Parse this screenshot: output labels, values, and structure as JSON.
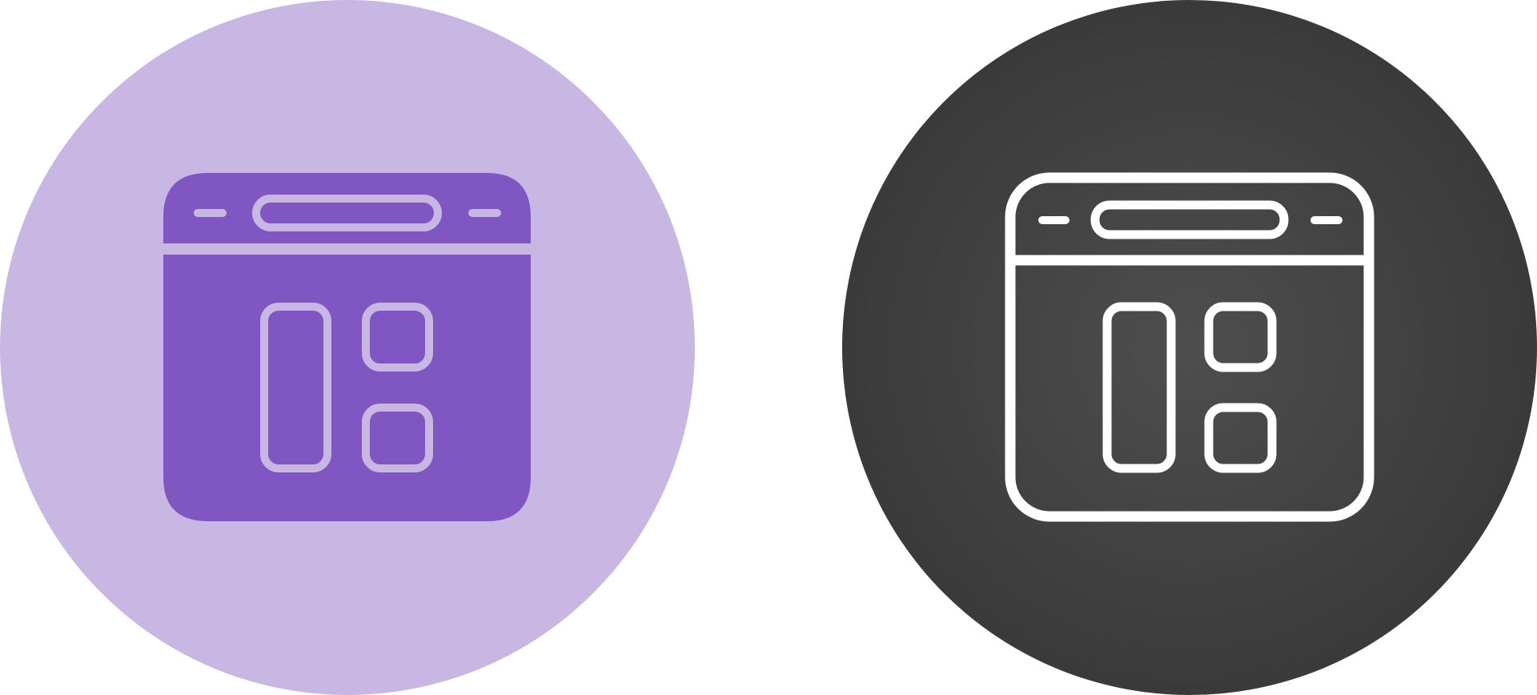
{
  "icons": [
    {
      "name": "browser-dashboard-icon",
      "style": "glyph",
      "background_color": "#c8b6e3",
      "fill_color": "#7f56c2",
      "stroke_color": "#c8b6e3"
    },
    {
      "name": "browser-dashboard-icon",
      "style": "outline",
      "background_color_center": "#4e4e4e",
      "background_color_edge": "#3a3a3a",
      "stroke_color": "#ffffff"
    }
  ]
}
